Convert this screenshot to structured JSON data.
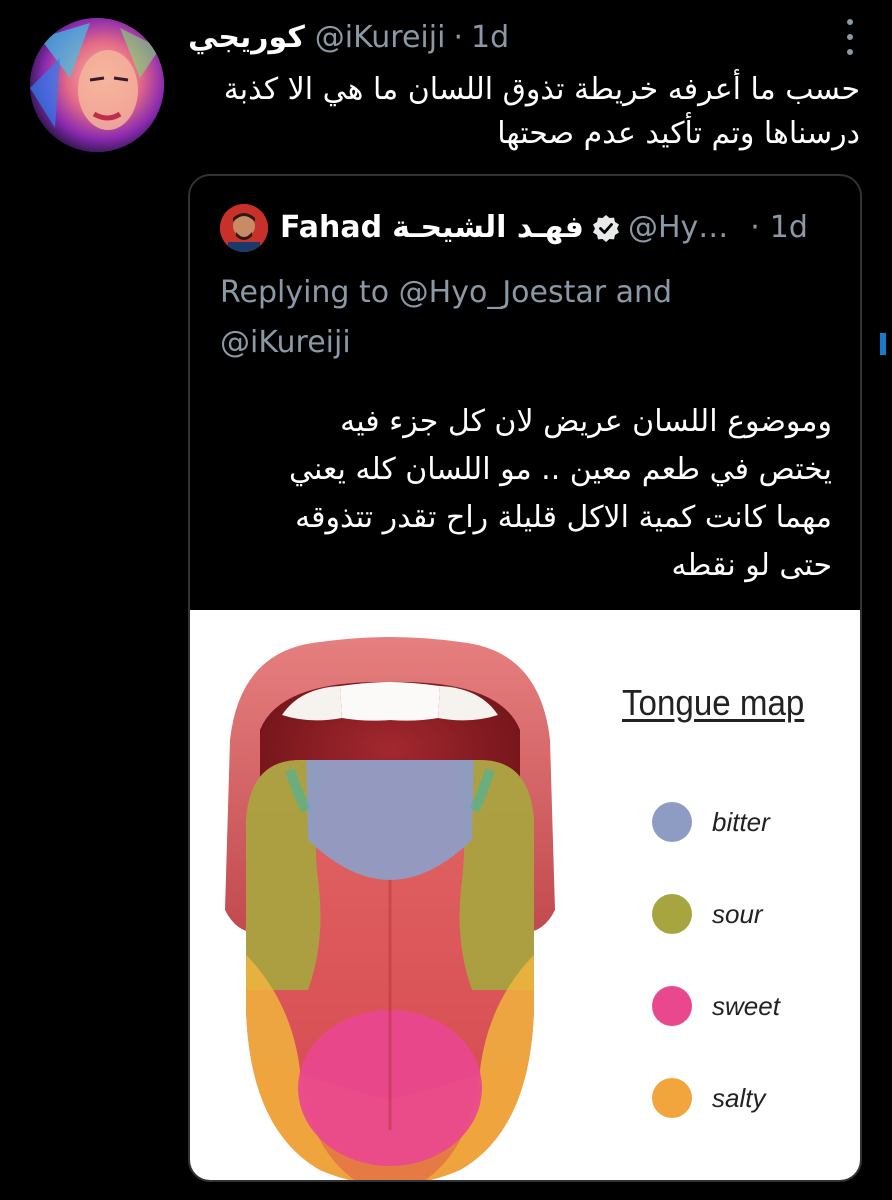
{
  "tweet": {
    "display_name": "كوريجي",
    "handle": "@iKureiji",
    "separator": "·",
    "time": "1d",
    "text_line1": "حسب ما أعرفه خريطة تذوق اللسان ما هي الا كذبة",
    "text_line2": "درسناها وتم تأكيد عدم صحتها",
    "avatar_icon": "avatar-icon",
    "more_icon": "more-options-icon"
  },
  "quote": {
    "name_latin": "Fahad",
    "name_arabic": "فهـد الشيحـة",
    "verified_icon": "verified-badge-icon",
    "handle": "@Hy…",
    "separator": "·",
    "time": "1d",
    "reply_line1": "Replying to @Hyo_Joestar and",
    "reply_line2": "@iKureiji",
    "text_lines": [
      "وموضوع اللسان عريض لان كل جزء فيه",
      "يختص في طعم معين .. مو اللسان كله يعني",
      "مهما كانت كمية الاكل قليلة راح تقدر تتذوقه",
      "حتى لو نقطه"
    ]
  },
  "image": {
    "title": "Tongue map",
    "legend": [
      {
        "label": "bitter",
        "color": "#8e9cc4"
      },
      {
        "label": "sour",
        "color": "#a7a53f"
      },
      {
        "label": "sweet",
        "color": "#e9488f"
      },
      {
        "label": "salty",
        "color": "#f2a43d"
      }
    ]
  },
  "colors": {
    "background": "#000000",
    "secondary_text": "#8b98a5",
    "card_border": "#2f3336"
  }
}
